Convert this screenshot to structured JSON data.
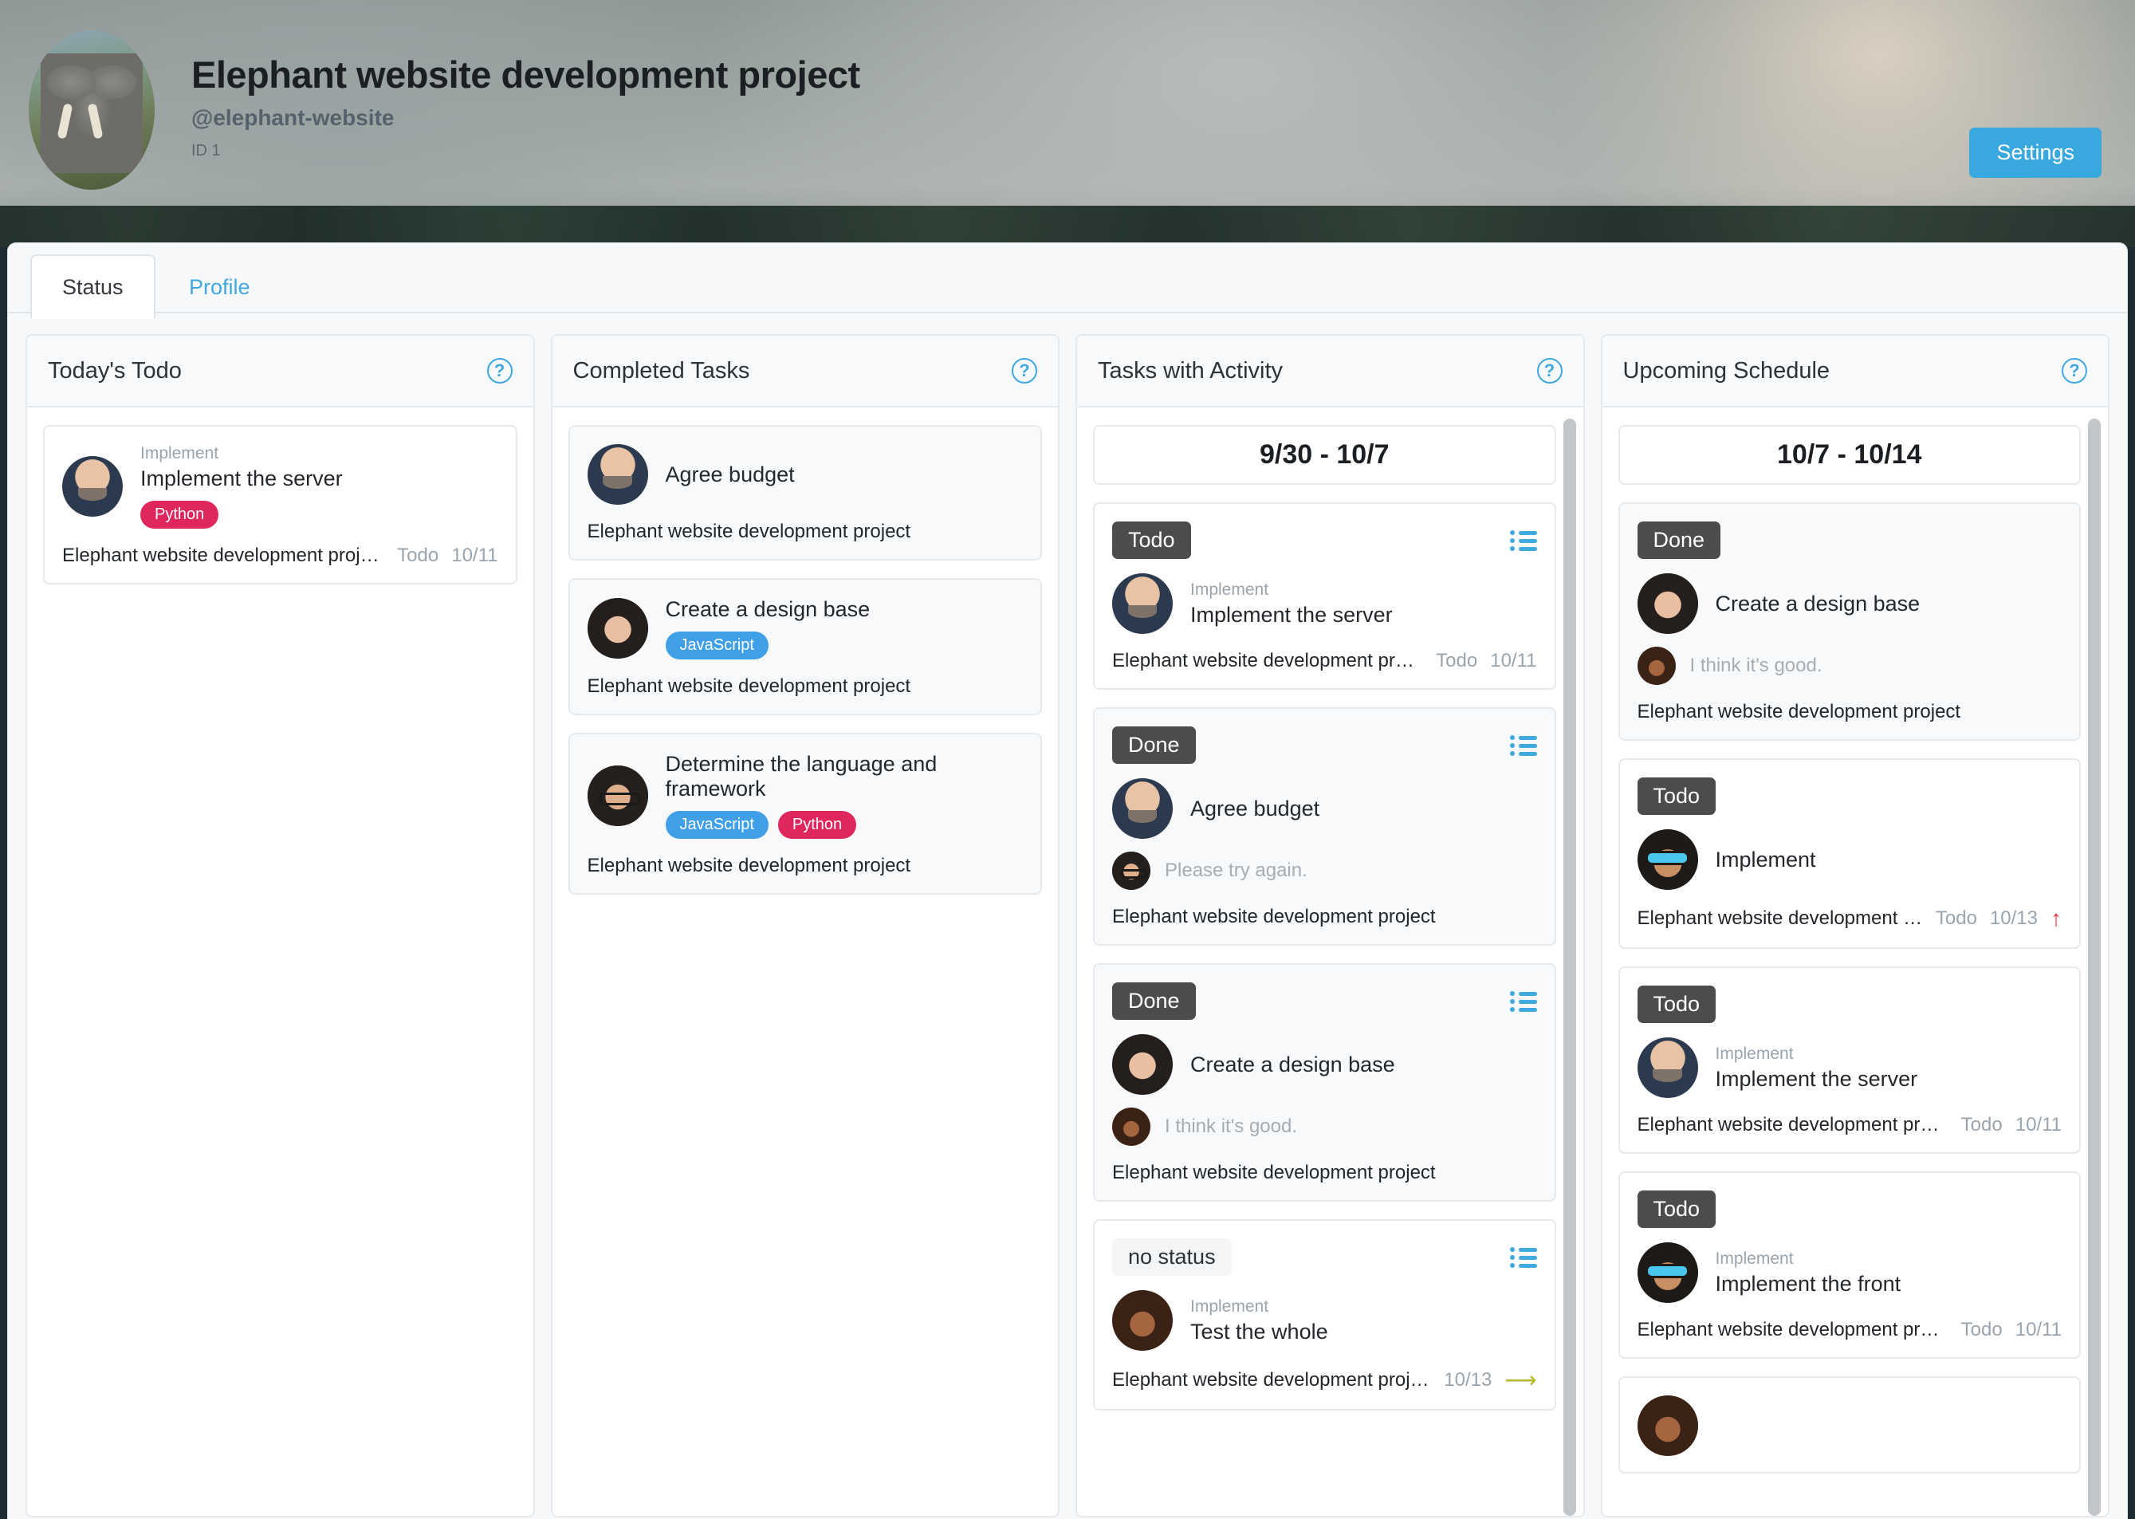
{
  "header": {
    "title": "Elephant website development project",
    "handle": "@elephant-website",
    "id_label": "ID 1",
    "settings_label": "Settings",
    "avatar_name": "elephant-avatar",
    "accent_color": "#39a8de"
  },
  "tabs": [
    {
      "label": "Status",
      "active": true
    },
    {
      "label": "Profile",
      "active": false
    }
  ],
  "columns": {
    "todays_todo": {
      "title": "Today's Todo",
      "help_icon": "question-icon",
      "cards": [
        {
          "kind": "Implement",
          "title": "Implement the server",
          "tags": [
            {
              "label": "Python",
              "color": "#e0275d"
            }
          ],
          "project": "Elephant website development project",
          "status": "Todo",
          "date": "10/11",
          "avatar": "f-bald"
        }
      ]
    },
    "completed_tasks": {
      "title": "Completed Tasks",
      "help_icon": "question-icon",
      "cards": [
        {
          "title": "Agree budget",
          "tags": [],
          "project": "Elephant website development project",
          "avatar": "f-bald"
        },
        {
          "title": "Create a design base",
          "tags": [
            {
              "label": "JavaScript",
              "color": "#3fa0e8"
            }
          ],
          "project": "Elephant website development project",
          "avatar": "f-darkhair"
        },
        {
          "title": "Determine the language and framework",
          "tags": [
            {
              "label": "JavaScript",
              "color": "#3fa0e8"
            },
            {
              "label": "Python",
              "color": "#e0275d"
            }
          ],
          "project": "Elephant website development project",
          "avatar": "f-glasses"
        }
      ]
    },
    "tasks_with_activity": {
      "title": "Tasks with Activity",
      "help_icon": "question-icon",
      "range": "9/30 - 10/7",
      "cards": [
        {
          "status_badge": "Todo",
          "list_icon": "list-icon",
          "kind": "Implement",
          "title": "Implement the server",
          "comment": null,
          "comment_avatar": null,
          "project": "Elephant website development proj…",
          "status": "Todo",
          "date": "10/11",
          "avatar": "f-bald"
        },
        {
          "status_badge": "Done",
          "list_icon": "list-icon",
          "kind": null,
          "title": "Agree budget",
          "comment": "Please try again.",
          "comment_avatar": "f-glasses",
          "project": "Elephant website development project",
          "status": null,
          "date": null,
          "avatar": "f-bald"
        },
        {
          "status_badge": "Done",
          "list_icon": "list-icon",
          "kind": null,
          "title": "Create a design base",
          "comment": "I think it's good.",
          "comment_avatar": "f-curly",
          "project": "Elephant website development project",
          "status": null,
          "date": null,
          "avatar": "f-darkhair"
        },
        {
          "status_badge": "no status",
          "list_icon": "list-icon",
          "kind": "Implement",
          "title": "Test the whole",
          "comment": null,
          "comment_avatar": null,
          "project": "Elephant website development project",
          "status": null,
          "date": "10/13",
          "trailing_icon": "arrow-right-icon",
          "avatar": "f-curly"
        }
      ]
    },
    "upcoming_schedule": {
      "title": "Upcoming Schedule",
      "help_icon": "question-icon",
      "range": "10/7 - 10/14",
      "cards": [
        {
          "status_badge": "Done",
          "kind": null,
          "title": "Create a design base",
          "comment": "I think it's good.",
          "comment_avatar": "f-curly",
          "project": "Elephant website development project",
          "status": null,
          "date": null,
          "avatar": "f-darkhair"
        },
        {
          "status_badge": "Todo",
          "kind": null,
          "title": "Implement",
          "comment": null,
          "comment_avatar": null,
          "project": "Elephant website development pr…",
          "status": "Todo",
          "date": "10/13",
          "trailing_icon": "arrow-up-icon",
          "avatar": "f-shades"
        },
        {
          "status_badge": "Todo",
          "kind": "Implement",
          "title": "Implement the server",
          "comment": null,
          "comment_avatar": null,
          "project": "Elephant website development proj…",
          "status": "Todo",
          "date": "10/11",
          "avatar": "f-bald"
        },
        {
          "status_badge": "Todo",
          "kind": "Implement",
          "title": "Implement the front",
          "comment": null,
          "comment_avatar": null,
          "project": "Elephant website development proj…",
          "status": "Todo",
          "date": "10/11",
          "avatar": "f-shades"
        }
      ]
    }
  }
}
